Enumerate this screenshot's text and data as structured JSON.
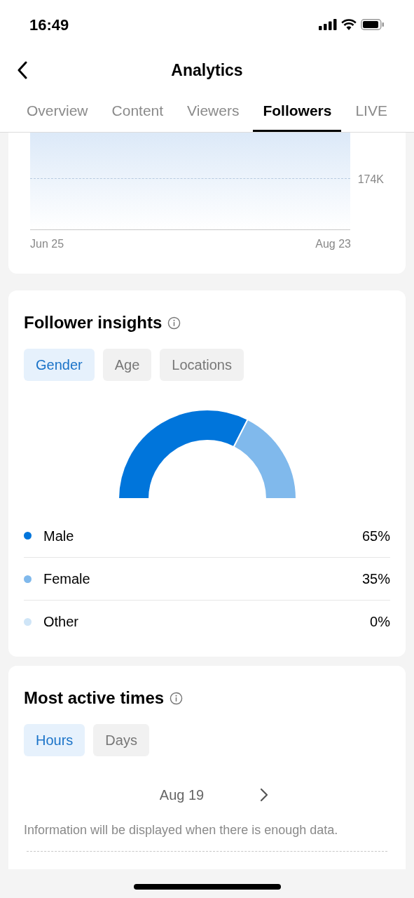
{
  "status_bar": {
    "time": "16:49"
  },
  "header": {
    "title": "Analytics"
  },
  "tabs": [
    {
      "label": "Overview",
      "selected": false
    },
    {
      "label": "Content",
      "selected": false
    },
    {
      "label": "Viewers",
      "selected": false
    },
    {
      "label": "Followers",
      "selected": true
    },
    {
      "label": "LIVE",
      "selected": false
    }
  ],
  "followers_chart": {
    "y_label": "174K",
    "x_start": "Jun 25",
    "x_end": "Aug 23"
  },
  "follower_insights": {
    "title": "Follower insights",
    "filters": [
      {
        "label": "Gender",
        "selected": true
      },
      {
        "label": "Age",
        "selected": false
      },
      {
        "label": "Locations",
        "selected": false
      }
    ],
    "legend": [
      {
        "label": "Male",
        "value": "65%",
        "color": "#0075db"
      },
      {
        "label": "Female",
        "value": "35%",
        "color": "#80b9ec"
      },
      {
        "label": "Other",
        "value": "0%",
        "color": "#cfe5f7"
      }
    ]
  },
  "most_active_times": {
    "title": "Most active times",
    "filters": [
      {
        "label": "Hours",
        "selected": true
      },
      {
        "label": "Days",
        "selected": false
      }
    ],
    "date": "Aug 19",
    "message": "Information will be displayed when there is enough data."
  }
}
